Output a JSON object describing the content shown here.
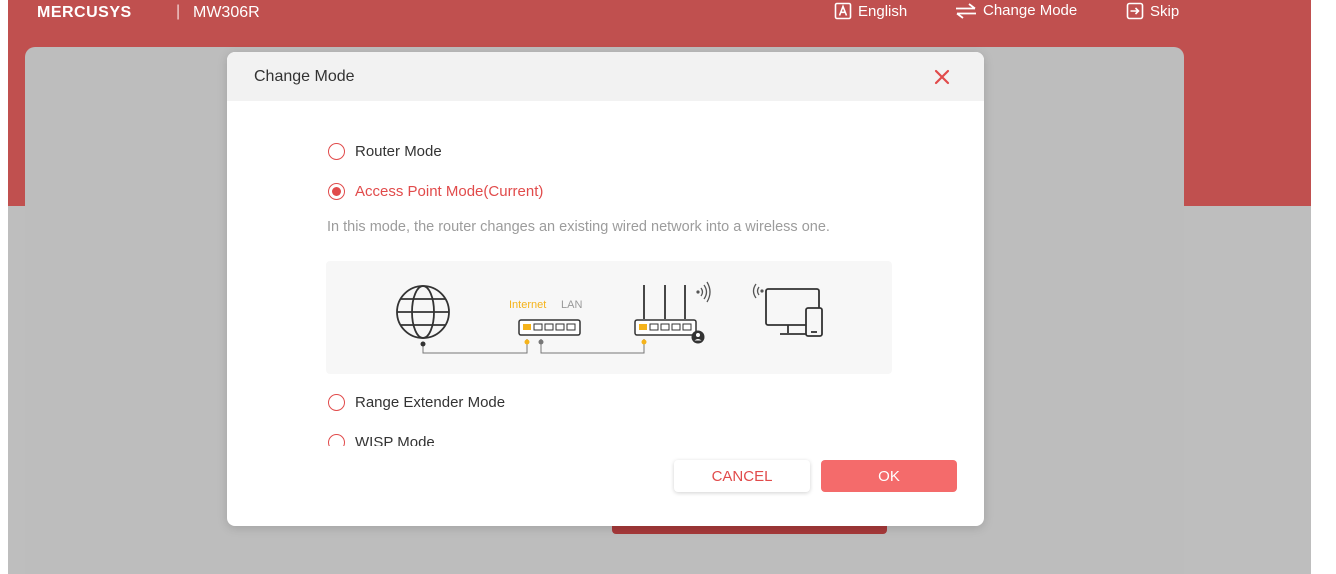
{
  "header": {
    "brand": "MERCUSYS",
    "separator": "|",
    "model": "MW306R",
    "nav": [
      {
        "icon": "language-icon",
        "label": "English"
      },
      {
        "icon": "change-mode-icon",
        "label": "Change Mode"
      },
      {
        "icon": "skip-icon",
        "label": "Skip"
      }
    ]
  },
  "modal": {
    "title": "Change Mode",
    "close_icon": "close-icon",
    "options": [
      {
        "label": "Router Mode",
        "selected": false
      },
      {
        "label": "Access Point Mode(Current)",
        "selected": true
      },
      {
        "label": "Range Extender Mode",
        "selected": false
      },
      {
        "label": "WISP Mode",
        "selected": false
      }
    ],
    "description": "In this mode, the router changes an existing wired network into a wireless one.",
    "diagram": {
      "internet_label": "Internet",
      "lan_label": "LAN"
    },
    "buttons": {
      "cancel": "CANCEL",
      "ok": "OK"
    }
  },
  "colors": {
    "brand_red": "#c0504f",
    "accent": "#e14b4b",
    "ok_button": "#f46b6b",
    "port_yellow": "#f5b31a"
  }
}
